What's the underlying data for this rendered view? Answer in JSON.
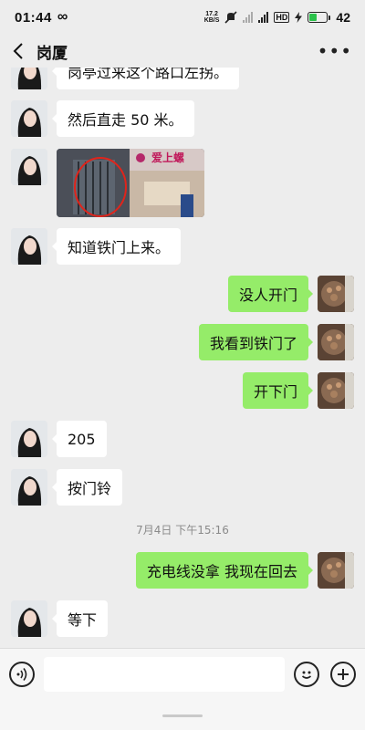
{
  "status_bar": {
    "time": "01:44",
    "loop_icon": "∞",
    "net_speed_value": "17.2",
    "net_speed_unit": "KB/S",
    "hd_label": "HD",
    "battery_level": "42",
    "battery_color": "#2bc24b"
  },
  "header": {
    "title": "岗厦",
    "back_icon": "chevron-left-icon",
    "more_icon": "more-dots-icon"
  },
  "messages": [
    {
      "side": "in",
      "type": "text",
      "text": "岗亭过来这个路口左拐。"
    },
    {
      "side": "in",
      "type": "text",
      "text": "然后直走 50 米。"
    },
    {
      "side": "in",
      "type": "image",
      "caption": "爱上螺"
    },
    {
      "side": "in",
      "type": "text",
      "text": "知道铁门上来。"
    },
    {
      "side": "out",
      "type": "text",
      "text": "没人开门"
    },
    {
      "side": "out",
      "type": "text",
      "text": "我看到铁门了"
    },
    {
      "side": "out",
      "type": "text",
      "text": "开下门"
    },
    {
      "side": "in",
      "type": "text",
      "text": "205"
    },
    {
      "side": "in",
      "type": "text",
      "text": "按门铃"
    },
    {
      "side": "time",
      "text": "7月4日 下午15:16"
    },
    {
      "side": "out",
      "type": "text",
      "text": "充电线没拿 我现在回去"
    },
    {
      "side": "in",
      "type": "text",
      "text": "等下"
    }
  ],
  "input_bar": {
    "voice_icon": "voice-icon",
    "emoji_icon": "emoji-icon",
    "plus_icon": "plus-icon",
    "text_value": ""
  },
  "colors": {
    "background": "#ededed",
    "outgoing_bubble": "#95ec69",
    "incoming_bubble": "#ffffff"
  }
}
